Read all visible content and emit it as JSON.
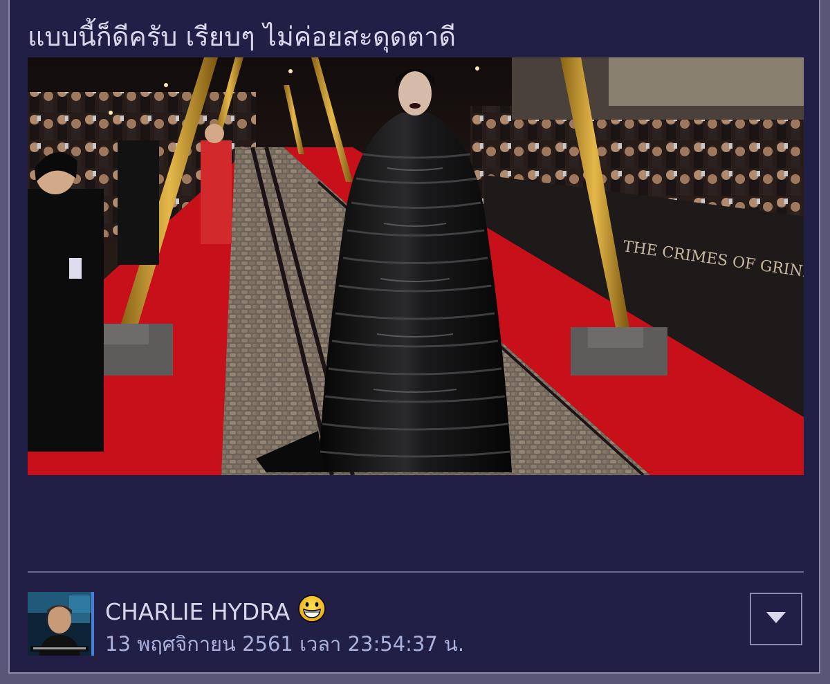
{
  "post": {
    "comment_text": "แบบนี้ก็ดีครับ เรียบๆ ไม่ค่อยสะดุดตาดี",
    "photo": {
      "banner_text": "THE CRIMES OF GRINDELWALD"
    },
    "author": {
      "name": "CHARLIE HYDRA",
      "emoji_icon": "grinning-face-icon",
      "timestamp": "13 พฤศจิกายน 2561 เวลา 23:54:37 น."
    },
    "menu_icon": "caret-down-icon"
  },
  "colors": {
    "background": "#221f47",
    "text": "#d9d7ea",
    "timestamp": "#aab3e0",
    "border": "#8f8aac",
    "red_carpet": "#c8101a"
  }
}
